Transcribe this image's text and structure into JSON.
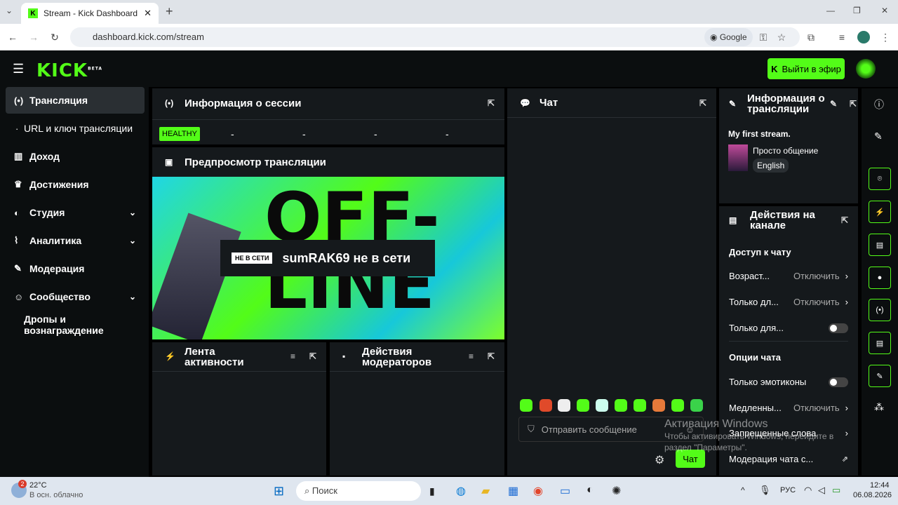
{
  "browser": {
    "tab_title": "Stream - Kick Dashboard",
    "url": "dashboard.kick.com/stream",
    "search_engine": "Google",
    "new_tab": "+"
  },
  "header": {
    "logo": "KICK",
    "logo_badge": "BETA",
    "go_live": "Выйти в эфир"
  },
  "sidebar": {
    "items": [
      {
        "label": "Трансляция"
      },
      {
        "label": "URL и ключ трансляции"
      },
      {
        "label": "Доход"
      },
      {
        "label": "Достижения"
      },
      {
        "label": "Студия"
      },
      {
        "label": "Аналитика"
      },
      {
        "label": "Модерация"
      },
      {
        "label": "Сообщество"
      },
      {
        "label": "Дропы и вознаграждение"
      }
    ]
  },
  "session": {
    "title": "Информация о сессии",
    "status": "HEALTHY",
    "stats": [
      "-",
      "-",
      "-",
      "-"
    ]
  },
  "preview": {
    "title": "Предпросмотр трансляции",
    "offline_badge": "НЕ В СЕТИ",
    "offline_text": "sumRAK69 не в сети",
    "banner_word": "OFF-LINE"
  },
  "activity": {
    "title": "Лента активности"
  },
  "mod_actions": {
    "title": "Действия модераторов"
  },
  "chat": {
    "title": "Чат",
    "placeholder": "Отправить сообщение",
    "send": "Чат"
  },
  "stream_info": {
    "title": "Информация о трансляции",
    "stream_title": "My first stream.",
    "category": "Просто общение",
    "language": "English"
  },
  "channel_actions": {
    "title": "Действия на канале",
    "chat_access": "Доступ к чату",
    "rows": [
      {
        "label": "Возраст...",
        "value": "Отключить"
      },
      {
        "label": "Только дл...",
        "value": "Отключить"
      },
      {
        "label": "Только для...",
        "value": ""
      }
    ],
    "chat_options": "Опции чата",
    "rows2": [
      {
        "label": "Только эмотиконы",
        "value": ""
      },
      {
        "label": "Медленны...",
        "value": "Отключить"
      },
      {
        "label": "Запрещенные слова",
        "value": ""
      },
      {
        "label": "Модерация чата с...",
        "value": ""
      }
    ]
  },
  "watermark": {
    "title": "Активация Windows",
    "text": "Чтобы активировать Windows, перейдите в раздел \"Параметры\"."
  },
  "taskbar": {
    "weather_temp": "22°C",
    "weather_desc": "В осн. облачно",
    "weather_badge": "2",
    "search": "Поиск",
    "lang": "РУС",
    "time": "12:44",
    "date": "06.08.2026"
  }
}
